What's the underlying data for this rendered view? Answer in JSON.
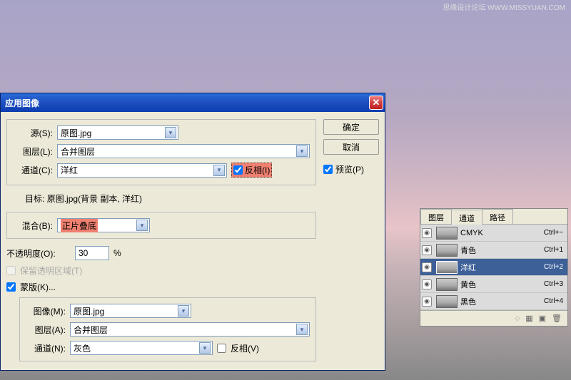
{
  "watermark": "思缘设计论坛 WWW.MISSYUAN.COM",
  "dialog": {
    "title": "应用图像",
    "source_label": "源(S):",
    "source_value": "原图.jpg",
    "layer_label": "图层(L):",
    "layer_value": "合并图层",
    "channel_label": "通道(C):",
    "channel_value": "洋红",
    "invert_label": "反相(I)",
    "target_label": "目标:",
    "target_value": "原图.jpg(背景 副本, 洋红)",
    "blend_label": "混合(B):",
    "blend_value": "正片叠底",
    "opacity_label": "不透明度(O):",
    "opacity_value": "30",
    "opacity_unit": "%",
    "preserve_label": "保留透明区域(T)",
    "mask_label": "蒙版(K)...",
    "mask_image_label": "图像(M):",
    "mask_image_value": "原图.jpg",
    "mask_layer_label": "图层(A):",
    "mask_layer_value": "合并图层",
    "mask_channel_label": "通道(N):",
    "mask_channel_value": "灰色",
    "mask_invert_label": "反相(V)",
    "ok": "确定",
    "cancel": "取消",
    "preview": "预览(P)"
  },
  "panel": {
    "tabs": [
      "图层",
      "通道",
      "路径"
    ],
    "active_tab": 1,
    "channels": [
      {
        "name": "CMYK",
        "shortcut": "Ctrl+~"
      },
      {
        "name": "青色",
        "shortcut": "Ctrl+1"
      },
      {
        "name": "洋红",
        "shortcut": "Ctrl+2"
      },
      {
        "name": "黄色",
        "shortcut": "Ctrl+3"
      },
      {
        "name": "黑色",
        "shortcut": "Ctrl+4"
      }
    ],
    "selected": 2
  }
}
